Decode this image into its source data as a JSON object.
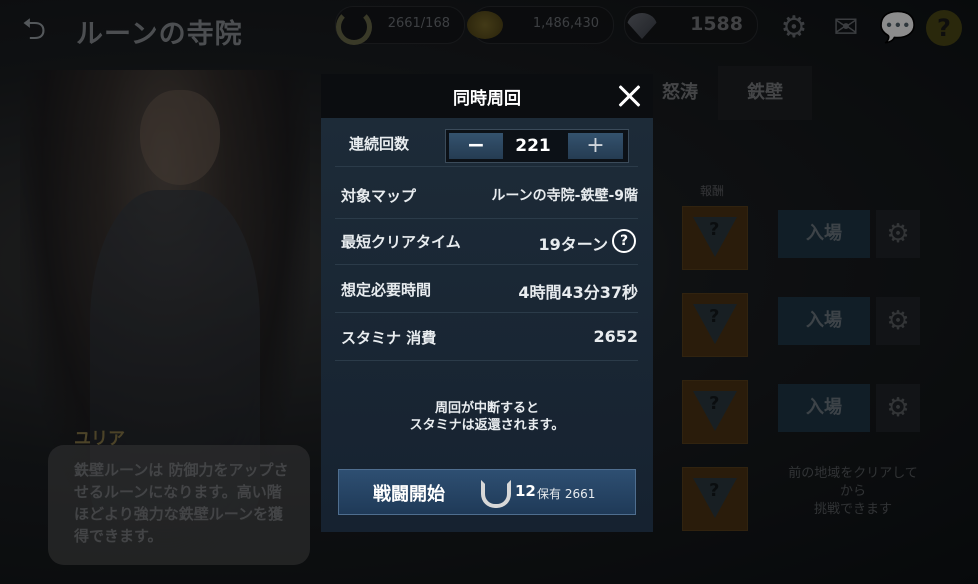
{
  "topbar": {
    "title": "ルーンの寺院",
    "stamina": "2661/168",
    "gold": "1,486,430",
    "gems": "1588"
  },
  "background": {
    "tabs": [
      "怒涛",
      "鉄壁"
    ],
    "reward_label": "報酬",
    "enter_label": "入場",
    "locked_text": "前の地域をクリアして\nから\n挑戦できます",
    "speaker": "ユリア",
    "speech": "鉄壁ルーンは 防御力をアップさせるルーンになります。高い階ほどより強力な鉄壁ルーンを獲得できます。"
  },
  "modal": {
    "title": "同時周回",
    "count_label": "連続回数",
    "count_value": "221",
    "minus": "−",
    "plus": "+",
    "map_label": "対象マップ",
    "map_value": "ルーンの寺院-鉄壁-9階",
    "cleartime_label": "最短クリアタイム",
    "cleartime_value": "19ターン",
    "required_label": "想定必要時間",
    "required_value": "4時間43分37秒",
    "stamina_label": "スタミナ 消費",
    "stamina_value": "2652",
    "notice_line1": "周回が中断すると",
    "notice_line2": "スタミナは返還されます。",
    "start_label": "戦闘開始",
    "cost": "12",
    "owned": "保有 2661"
  }
}
